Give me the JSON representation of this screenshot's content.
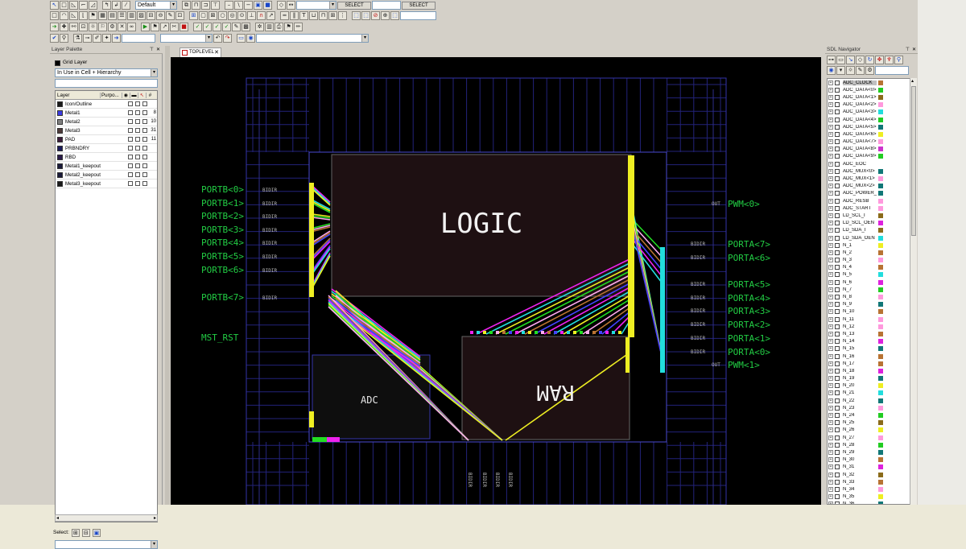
{
  "toolbar": {
    "row1_combo": "Default",
    "select_btn_1": "SELECT",
    "select_btn_2": "SELECT"
  },
  "layer_palette": {
    "title": "Layer Palette",
    "grid_layer": "Grid Layer",
    "filter": "In Use in Cell + Hierarchy",
    "columns": {
      "layer": "Layer",
      "purpose": "Purpo...",
      "count": "#"
    },
    "layers": [
      {
        "name": "Icon/Outline",
        "color": "#1a1a1a",
        "count": ""
      },
      {
        "name": "Metal1",
        "color": "#3a3ae0",
        "count": "8"
      },
      {
        "name": "Metal2",
        "color": "#7f7f7f",
        "count": "10"
      },
      {
        "name": "Metal3",
        "color": "#4d3a3a",
        "count": "31"
      },
      {
        "name": "PAD",
        "color": "#3a1a3a",
        "count": "11"
      },
      {
        "name": "PRBNDRY",
        "color": "#1a1a5a",
        "count": ""
      },
      {
        "name": "RBD",
        "color": "#2a1a4a",
        "count": ""
      },
      {
        "name": "Metal1_keepout",
        "color": "#1a1a3a",
        "count": ""
      },
      {
        "name": "Metal2_keepout",
        "color": "#1a1a3a",
        "count": ""
      },
      {
        "name": "Metal3_keepout",
        "color": "#1a1a1a",
        "count": ""
      }
    ],
    "select_label": "Select:"
  },
  "canvas": {
    "tab_label": "TOPLEVEL",
    "blocks": {
      "logic": "LOGIC",
      "ram": "RAM",
      "adc": "ADC"
    },
    "left_pins": [
      "PORTB<0>",
      "PORTB<1>",
      "PORTB<2>",
      "PORTB<3>",
      "PORTB<4>",
      "PORTB<5>",
      "PORTB<6>",
      "PORTB<7>",
      "MST_RST"
    ],
    "right_pins": [
      "PWM<0>",
      "PORTA<7>",
      "PORTA<6>",
      "PORTA<5>",
      "PORTA<4>",
      "PORTA<3>",
      "PORTA<2>",
      "PORTA<1>",
      "PORTA<0>",
      "PWM<1>"
    ],
    "bidir": "BIDIR",
    "out": "OUT"
  },
  "sdl_navigator": {
    "title": "SDL Navigator",
    "nets": [
      {
        "name": "ADC_CLOCK",
        "color": "#b87333"
      },
      {
        "name": "ADC_DATA<0>",
        "color": "#22cc22"
      },
      {
        "name": "ADC_DATA<1>",
        "color": "#8b6b1a"
      },
      {
        "name": "ADC_DATA<2>",
        "color": "#ff99dd"
      },
      {
        "name": "ADC_DATA<3>",
        "color": "#22dddd"
      },
      {
        "name": "ADC_DATA<4>",
        "color": "#22cc22"
      },
      {
        "name": "ADC_DATA<5>",
        "color": "#117777"
      },
      {
        "name": "ADC_DATA<6>",
        "color": "#eeee22"
      },
      {
        "name": "ADC_DATA<7>",
        "color": "#ff99dd"
      },
      {
        "name": "ADC_DATA<8>",
        "color": "#cc33cc"
      },
      {
        "name": "ADC_DATA<9>",
        "color": "#22cc22"
      },
      {
        "name": "ADC_EOC",
        "color": ""
      },
      {
        "name": "ADC_MUX<0>",
        "color": "#117777"
      },
      {
        "name": "ADC_MUX<1>",
        "color": "#ff99dd"
      },
      {
        "name": "ADC_MUX<2>",
        "color": "#117777"
      },
      {
        "name": "ADC_POWER_D",
        "color": "#117777"
      },
      {
        "name": "ADC_RESB",
        "color": "#ff99dd"
      },
      {
        "name": "ADC_START",
        "color": "#ff99dd"
      },
      {
        "name": "LD_SCL_I",
        "color": "#8b6b1a"
      },
      {
        "name": "LD_SCL_OEN",
        "color": "#dd22dd"
      },
      {
        "name": "LD_SDA_I",
        "color": "#8b6b1a"
      },
      {
        "name": "LD_SDA_OEN",
        "color": "#22dddd"
      },
      {
        "name": "N_1",
        "color": "#eeee22"
      },
      {
        "name": "N_2",
        "color": "#b87333"
      },
      {
        "name": "N_3",
        "color": "#ff99dd"
      },
      {
        "name": "N_4",
        "color": "#b87333"
      },
      {
        "name": "N_5",
        "color": "#22dddd"
      },
      {
        "name": "N_6",
        "color": "#dd22dd"
      },
      {
        "name": "N_7",
        "color": "#22cc22"
      },
      {
        "name": "N_8",
        "color": "#ff99dd"
      },
      {
        "name": "N_9",
        "color": "#117777"
      },
      {
        "name": "N_10",
        "color": "#b87333"
      },
      {
        "name": "N_11",
        "color": "#ff99dd"
      },
      {
        "name": "N_12",
        "color": "#ff99dd"
      },
      {
        "name": "N_13",
        "color": "#b87333"
      },
      {
        "name": "N_14",
        "color": "#dd22dd"
      },
      {
        "name": "N_15",
        "color": "#117777"
      },
      {
        "name": "N_16",
        "color": "#b87333"
      },
      {
        "name": "N_17",
        "color": "#b87333"
      },
      {
        "name": "N_18",
        "color": "#dd22dd"
      },
      {
        "name": "N_19",
        "color": "#117777"
      },
      {
        "name": "N_20",
        "color": "#eeee22"
      },
      {
        "name": "N_21",
        "color": "#22dddd"
      },
      {
        "name": "N_22",
        "color": "#117777"
      },
      {
        "name": "N_23",
        "color": "#ff99dd"
      },
      {
        "name": "N_24",
        "color": "#22cc22"
      },
      {
        "name": "N_25",
        "color": "#8b6b1a"
      },
      {
        "name": "N_26",
        "color": "#eeee22"
      },
      {
        "name": "N_27",
        "color": "#ff99dd"
      },
      {
        "name": "N_28",
        "color": "#22cc22"
      },
      {
        "name": "N_29",
        "color": "#117777"
      },
      {
        "name": "N_30",
        "color": "#b87333"
      },
      {
        "name": "N_31",
        "color": "#dd22dd"
      },
      {
        "name": "N_32",
        "color": "#8b6b1a"
      },
      {
        "name": "N_33",
        "color": "#b87333"
      },
      {
        "name": "N_34",
        "color": "#ff99dd"
      },
      {
        "name": "N_35",
        "color": "#eeee22"
      },
      {
        "name": "N_36",
        "color": "#117777"
      }
    ]
  }
}
